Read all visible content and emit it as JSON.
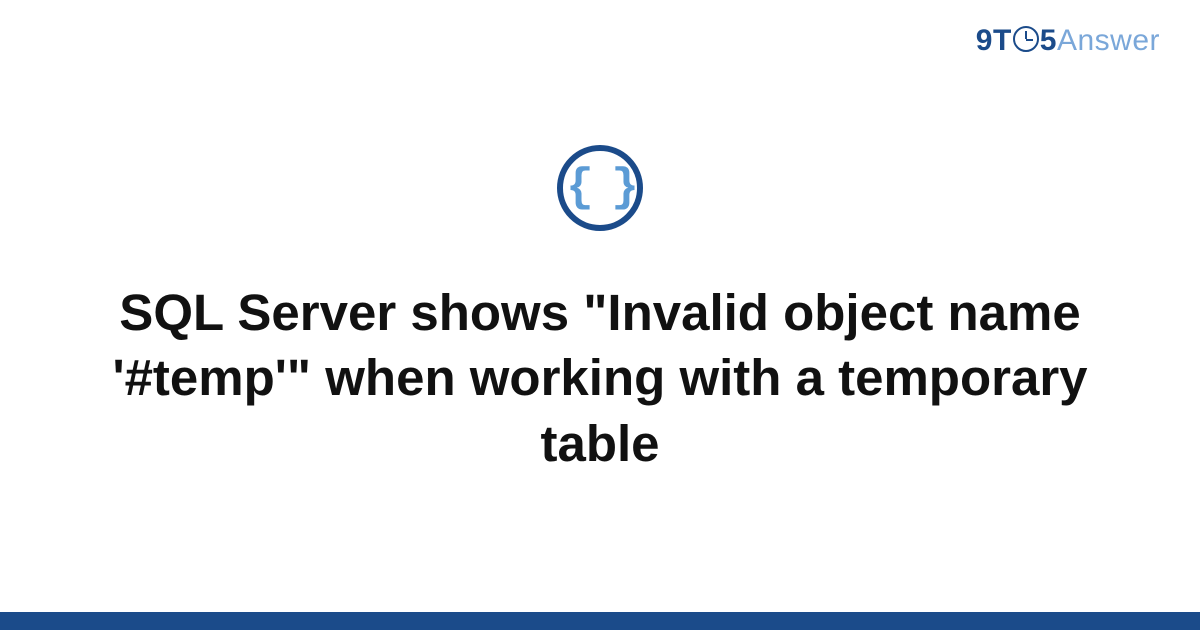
{
  "brand": {
    "nine": "9",
    "t": "T",
    "five": "5",
    "answer": "Answer"
  },
  "icon": {
    "braces": "{ }"
  },
  "title": "SQL Server shows \"Invalid object name '#temp'\" when working with a temporary table"
}
